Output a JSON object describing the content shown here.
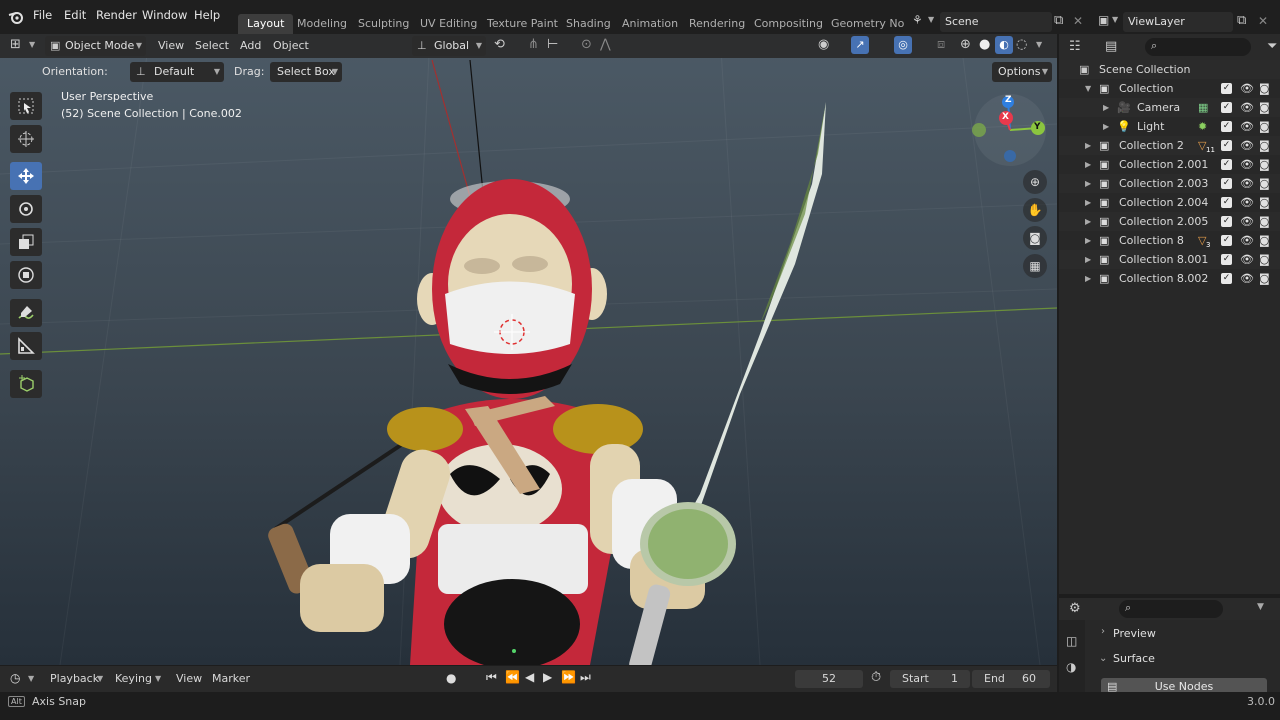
{
  "menu": {
    "logo": "blender-logo",
    "items": [
      "File",
      "Edit",
      "Render",
      "Window",
      "Help"
    ]
  },
  "workspaces": [
    "Layout",
    "Modeling",
    "Sculpting",
    "UV Editing",
    "Texture Paint",
    "Shading",
    "Animation",
    "Rendering",
    "Compositing",
    "Geometry Nod"
  ],
  "scene": {
    "label": "Scene"
  },
  "viewlayer": {
    "label": "ViewLayer"
  },
  "viewport_header": {
    "mode": "Object Mode",
    "menus": [
      "View",
      "Select",
      "Add",
      "Object"
    ],
    "orientation": "Global"
  },
  "tool_options": {
    "orientation_label": "Orientation:",
    "orientation_value": "Default",
    "drag_label": "Drag:",
    "drag_value": "Select Box",
    "options": "Options"
  },
  "overlay_text": {
    "perspective": "User Perspective",
    "context": "(52) Scene Collection | Cone.002"
  },
  "gizmo": {
    "z": "Z",
    "x": "X",
    "y": "Y"
  },
  "outliner": {
    "root": "Scene Collection",
    "rows": [
      {
        "label": "Collection",
        "indent": 1,
        "expanded": true,
        "icon": "collection-icon"
      },
      {
        "label": "Camera",
        "indent": 2,
        "icon": "camera-icon",
        "badge": "camera-data-icon"
      },
      {
        "label": "Light",
        "indent": 2,
        "icon": "light-icon",
        "badge": "light-data-icon"
      },
      {
        "label": "Collection 2",
        "indent": 1,
        "icon": "collection-icon",
        "badge": "cone-icon",
        "badge_count": "11"
      },
      {
        "label": "Collection 2.001",
        "indent": 1,
        "icon": "collection-icon"
      },
      {
        "label": "Collection 2.003",
        "indent": 1,
        "icon": "collection-icon"
      },
      {
        "label": "Collection 2.004",
        "indent": 1,
        "icon": "collection-icon"
      },
      {
        "label": "Collection 2.005",
        "indent": 1,
        "icon": "collection-icon"
      },
      {
        "label": "Collection 8",
        "indent": 1,
        "icon": "collection-icon",
        "badge": "cone-icon",
        "badge_count": "3"
      },
      {
        "label": "Collection 8.001",
        "indent": 1,
        "icon": "collection-icon"
      },
      {
        "label": "Collection 8.002",
        "indent": 1,
        "icon": "collection-icon"
      }
    ]
  },
  "properties": {
    "panels": [
      "Preview",
      "Surface"
    ],
    "button": "Use Nodes"
  },
  "timeline": {
    "menus": [
      "Playback",
      "Keying",
      "View",
      "Marker"
    ],
    "current_frame": "52",
    "start_label": "Start",
    "start": "1",
    "end_label": "End",
    "end": "60"
  },
  "status": {
    "key": "Alt",
    "hint": "Axis Snap",
    "version": "3.0.0"
  },
  "colors": {
    "accent": "#4772b3",
    "bg": "#1d1d1d",
    "panel": "#282828",
    "header": "#2a2a2a",
    "x_axis": "#e8394c",
    "y_axis": "#8bc53f",
    "z_axis": "#2f7fe0"
  }
}
